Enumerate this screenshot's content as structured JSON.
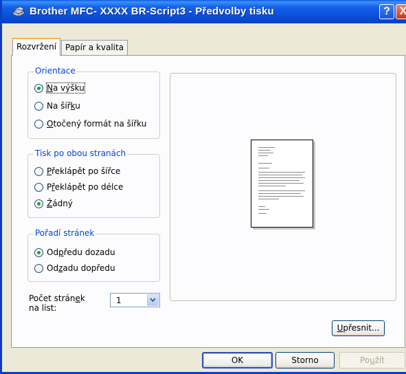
{
  "window": {
    "title": "Brother MFC- XXXX   BR-Script3 - Předvolby tisku",
    "help_label": "?",
    "close_label": "X"
  },
  "tabs": [
    {
      "label": "Rozvržení",
      "active": true
    },
    {
      "label": "Papír a kvalita",
      "active": false
    }
  ],
  "orientation": {
    "legend": "Orientace",
    "options": [
      {
        "pre": "",
        "ul": "N",
        "post": "a výšku",
        "checked": true
      },
      {
        "pre": "Na šíř",
        "ul": "k",
        "post": "u",
        "checked": false
      },
      {
        "pre": "",
        "ul": "O",
        "post": "točený formát na šířku",
        "checked": false
      }
    ]
  },
  "duplex": {
    "legend": "Tisk po obou stranách",
    "options": [
      {
        "pre": "",
        "ul": "P",
        "post": "řeklápět po šířce",
        "checked": false
      },
      {
        "pre": "P",
        "ul": "ř",
        "post": "eklápět po délce",
        "checked": false
      },
      {
        "pre": "",
        "ul": "Ž",
        "post": "ádný",
        "checked": true
      }
    ]
  },
  "page_order": {
    "legend": "Pořadí stránek",
    "options": [
      {
        "pre": "Od",
        "ul": "p",
        "post": "ředu dozadu",
        "checked": true
      },
      {
        "pre": "Od",
        "ul": "z",
        "post": "adu dopředu",
        "checked": false
      }
    ]
  },
  "pages_per_sheet": {
    "label_line1_pre": "Počet strán",
    "label_line1_ul": "e",
    "label_line1_post": "k",
    "label_line2": "na list:",
    "value": "1"
  },
  "buttons": {
    "advanced": {
      "pre": "",
      "ul": "U",
      "post": "přesnit..."
    },
    "ok": "OK",
    "cancel": "Storno",
    "apply": {
      "pre": "Po",
      "ul": "u",
      "post": "žít"
    }
  }
}
